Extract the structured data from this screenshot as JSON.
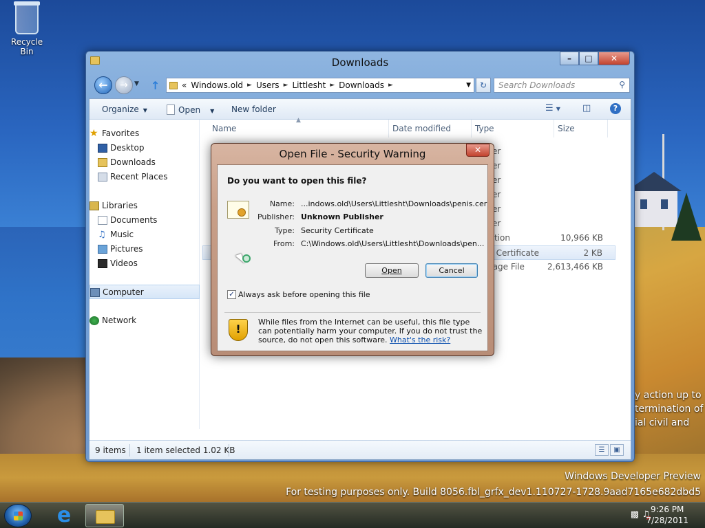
{
  "desktop": {
    "recycle_bin_label": "Recycle Bin",
    "legal_lines": [
      "y action up to",
      "termination of",
      "ial civil and"
    ],
    "watermark_line1": "Windows Developer Preview",
    "watermark_line2": "For testing purposes only. Build 8056.fbl_grfx_dev1.110727-1728.9aad7165e682dbd5"
  },
  "explorer": {
    "title": "Downloads",
    "address": {
      "prefix": "«",
      "crumbs": [
        "Windows.old",
        "Users",
        "Littlesht",
        "Downloads"
      ]
    },
    "search_placeholder": "Search Downloads",
    "commands": {
      "organize": "Organize",
      "open": "Open",
      "new_folder": "New folder"
    },
    "nav": {
      "favorites": {
        "label": "Favorites",
        "items": [
          "Desktop",
          "Downloads",
          "Recent Places"
        ]
      },
      "libraries": {
        "label": "Libraries",
        "items": [
          "Documents",
          "Music",
          "Pictures",
          "Videos"
        ]
      },
      "computer": "Computer",
      "network": "Network"
    },
    "columns": {
      "name": "Name",
      "date_modified": "Date modified",
      "type": "Type",
      "size": "Size"
    },
    "rows": [
      {
        "type": "lder",
        "size": ""
      },
      {
        "type": "lder",
        "size": ""
      },
      {
        "type": "lder",
        "size": ""
      },
      {
        "type": "lder",
        "size": ""
      },
      {
        "type": "lder",
        "size": ""
      },
      {
        "type": "lder",
        "size": ""
      },
      {
        "type": "cation",
        "size": "10,966 KB"
      },
      {
        "type": "ty Certificate",
        "size": "2 KB"
      },
      {
        "type": "mage File",
        "size": "2,613,466 KB"
      }
    ],
    "status": {
      "items": "9 items",
      "selected": "1 item selected  1.02 KB"
    }
  },
  "dialog": {
    "title": "Open File - Security Warning",
    "question": "Do you want to open this file?",
    "fields": {
      "name_label": "Name:",
      "name_value": "...indows.old\\Users\\Littlesht\\Downloads\\penis.cer",
      "publisher_label": "Publisher:",
      "publisher_value": "Unknown Publisher",
      "type_label": "Type:",
      "type_value": "Security Certificate",
      "from_label": "From:",
      "from_value": "C:\\Windows.old\\Users\\Littlesht\\Downloads\\pen..."
    },
    "open_button": "Open",
    "cancel_button": "Cancel",
    "always_ask_label": "Always ask before opening this file",
    "always_ask_checked": true,
    "warning_text": "While files from the Internet can be useful, this file type can potentially harm your computer. If you do not trust the source, do not open this software. ",
    "warning_link": "What's the risk?"
  },
  "taskbar": {
    "time": "9:26 PM",
    "date": "7/28/2011"
  }
}
